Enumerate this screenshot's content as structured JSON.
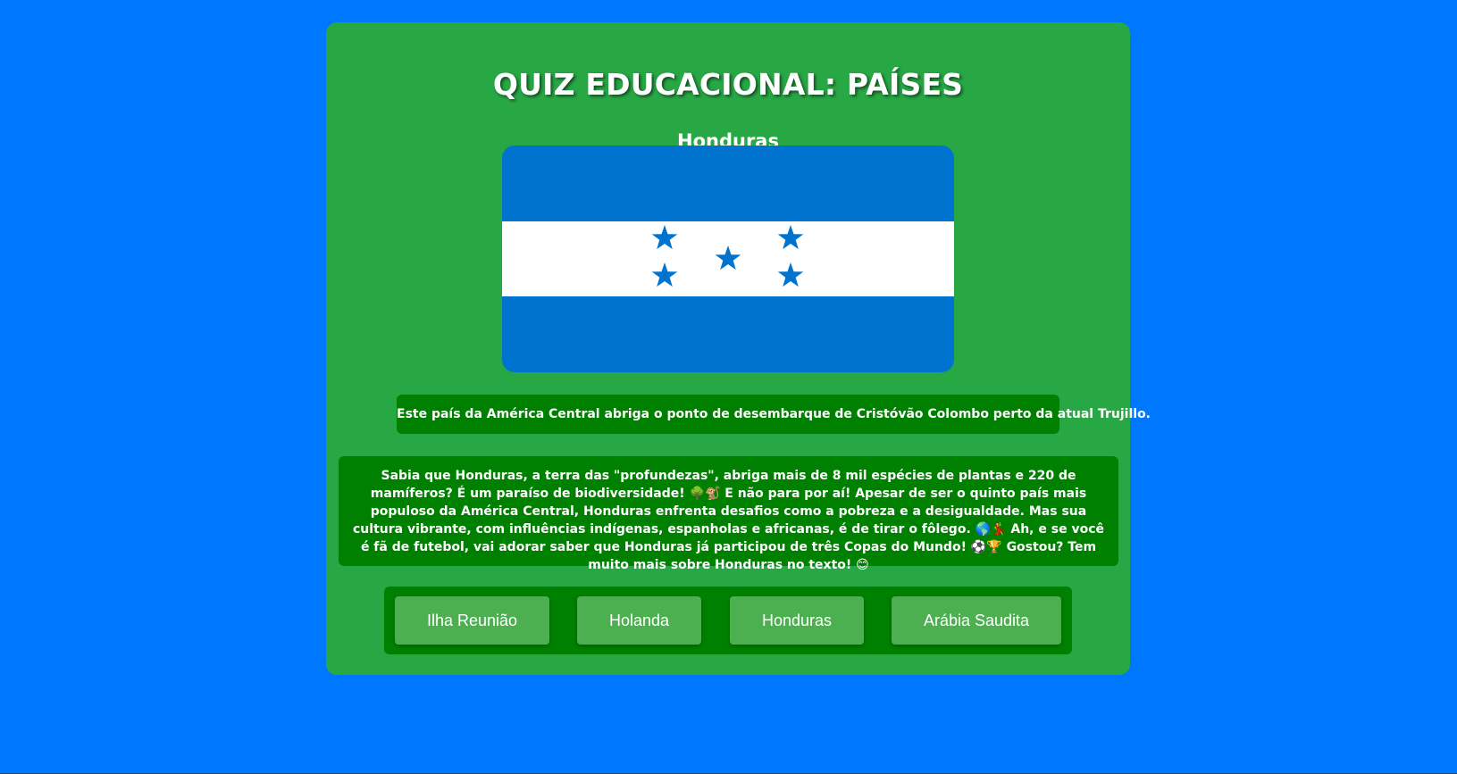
{
  "quiz": {
    "title": "QUIZ EDUCACIONAL: PAÍSES",
    "country_name": "Honduras",
    "flag": {
      "icon": "honduras-flag",
      "colors": {
        "blue": "#0073cf",
        "white": "#ffffff"
      }
    },
    "hint": "Este país da América Central abriga o ponto de desembarque de Cristóvão Colombo perto da atual Trujillo.",
    "fact": "Sabia que Honduras, a terra das \"profundezas\", abriga mais de 8 mil espécies de plantas e 220 de mamíferos? É um paraíso de biodiversidade! 🌳🐒 E não para por aí! Apesar de ser o quinto país mais populoso da América Central, Honduras enfrenta desafios como a pobreza e a desigualdade. Mas sua cultura vibrante, com influências indígenas, espanholas e africanas, é de tirar o fôlego. 🌎💃 Ah, e se você é fã de futebol, vai adorar saber que Honduras já participou de três Copas do Mundo! ⚽🏆 Gostou? Tem muito mais sobre Honduras no texto! 😊",
    "options": [
      "Ilha Reunião",
      "Holanda",
      "Honduras",
      "Arábia Saudita"
    ]
  },
  "colors": {
    "page_background": "#0077ff",
    "card_background": "#28a745",
    "panel_background": "#008000",
    "option_background": "#4caf50"
  }
}
